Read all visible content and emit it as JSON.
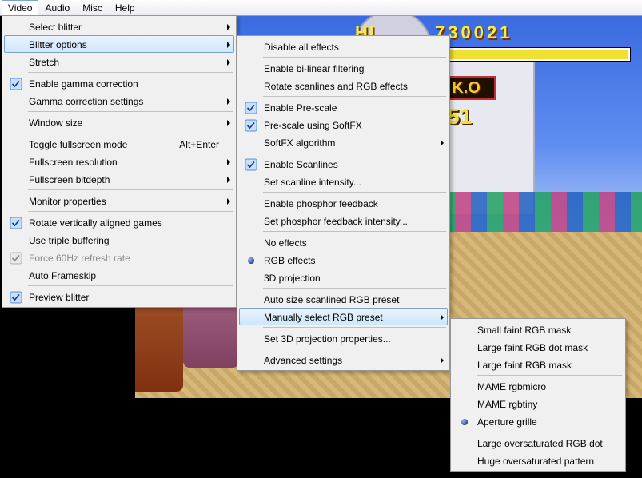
{
  "menubar": {
    "items": [
      "Video",
      "Audio",
      "Misc",
      "Help"
    ],
    "active_index": 0
  },
  "video_menu": {
    "select_blitter": "Select blitter",
    "blitter_options": "Blitter options",
    "stretch": "Stretch",
    "enable_gamma": "Enable gamma correction",
    "gamma_settings": "Gamma correction settings",
    "window_size": "Window size",
    "toggle_fullscreen": "Toggle fullscreen mode",
    "toggle_fullscreen_shortcut": "Alt+Enter",
    "fullscreen_resolution": "Fullscreen resolution",
    "fullscreen_bitdepth": "Fullscreen bitdepth",
    "monitor_properties": "Monitor properties",
    "rotate_vertical": "Rotate vertically aligned games",
    "triple_buffering": "Use triple buffering",
    "force_60hz": "Force 60Hz refresh rate",
    "auto_frameskip": "Auto Frameskip",
    "preview_blitter": "Preview blitter"
  },
  "blitter_options_menu": {
    "disable_all": "Disable all effects",
    "enable_bilinear": "Enable bi-linear filtering",
    "rotate_scanlines": "Rotate scanlines and RGB effects",
    "enable_prescale": "Enable Pre-scale",
    "prescale_softfx": "Pre-scale using SoftFX",
    "softfx_algorithm": "SoftFX algorithm",
    "enable_scanlines": "Enable Scanlines",
    "set_scanline_intensity": "Set scanline intensity...",
    "enable_phosphor": "Enable phosphor feedback",
    "set_phosphor_intensity": "Set phosphor feedback intensity...",
    "no_effects": "No effects",
    "rgb_effects": "RGB effects",
    "proj3d": "3D projection",
    "auto_size_rgb": "Auto size scanlined RGB preset",
    "manually_select_rgb": "Manually select RGB preset",
    "set_3d_properties": "Set 3D projection properties...",
    "advanced_settings": "Advanced settings"
  },
  "rgb_preset_menu": {
    "small_faint_mask": "Small faint RGB mask",
    "large_faint_dot_mask": "Large faint RGB dot mask",
    "large_faint_mask": "Large faint RGB mask",
    "mame_rgbmicro": "MAME rgbmicro",
    "mame_rgbtiny": "MAME rgbtiny",
    "aperture_grille": "Aperture grille",
    "large_oversat_dot": "Large oversaturated RGB dot",
    "huge_oversat_pattern": "Huge oversaturated pattern"
  },
  "game": {
    "hi_label": "HI",
    "hi_score": "730021",
    "ko_label": "K.O",
    "counter": "51"
  }
}
